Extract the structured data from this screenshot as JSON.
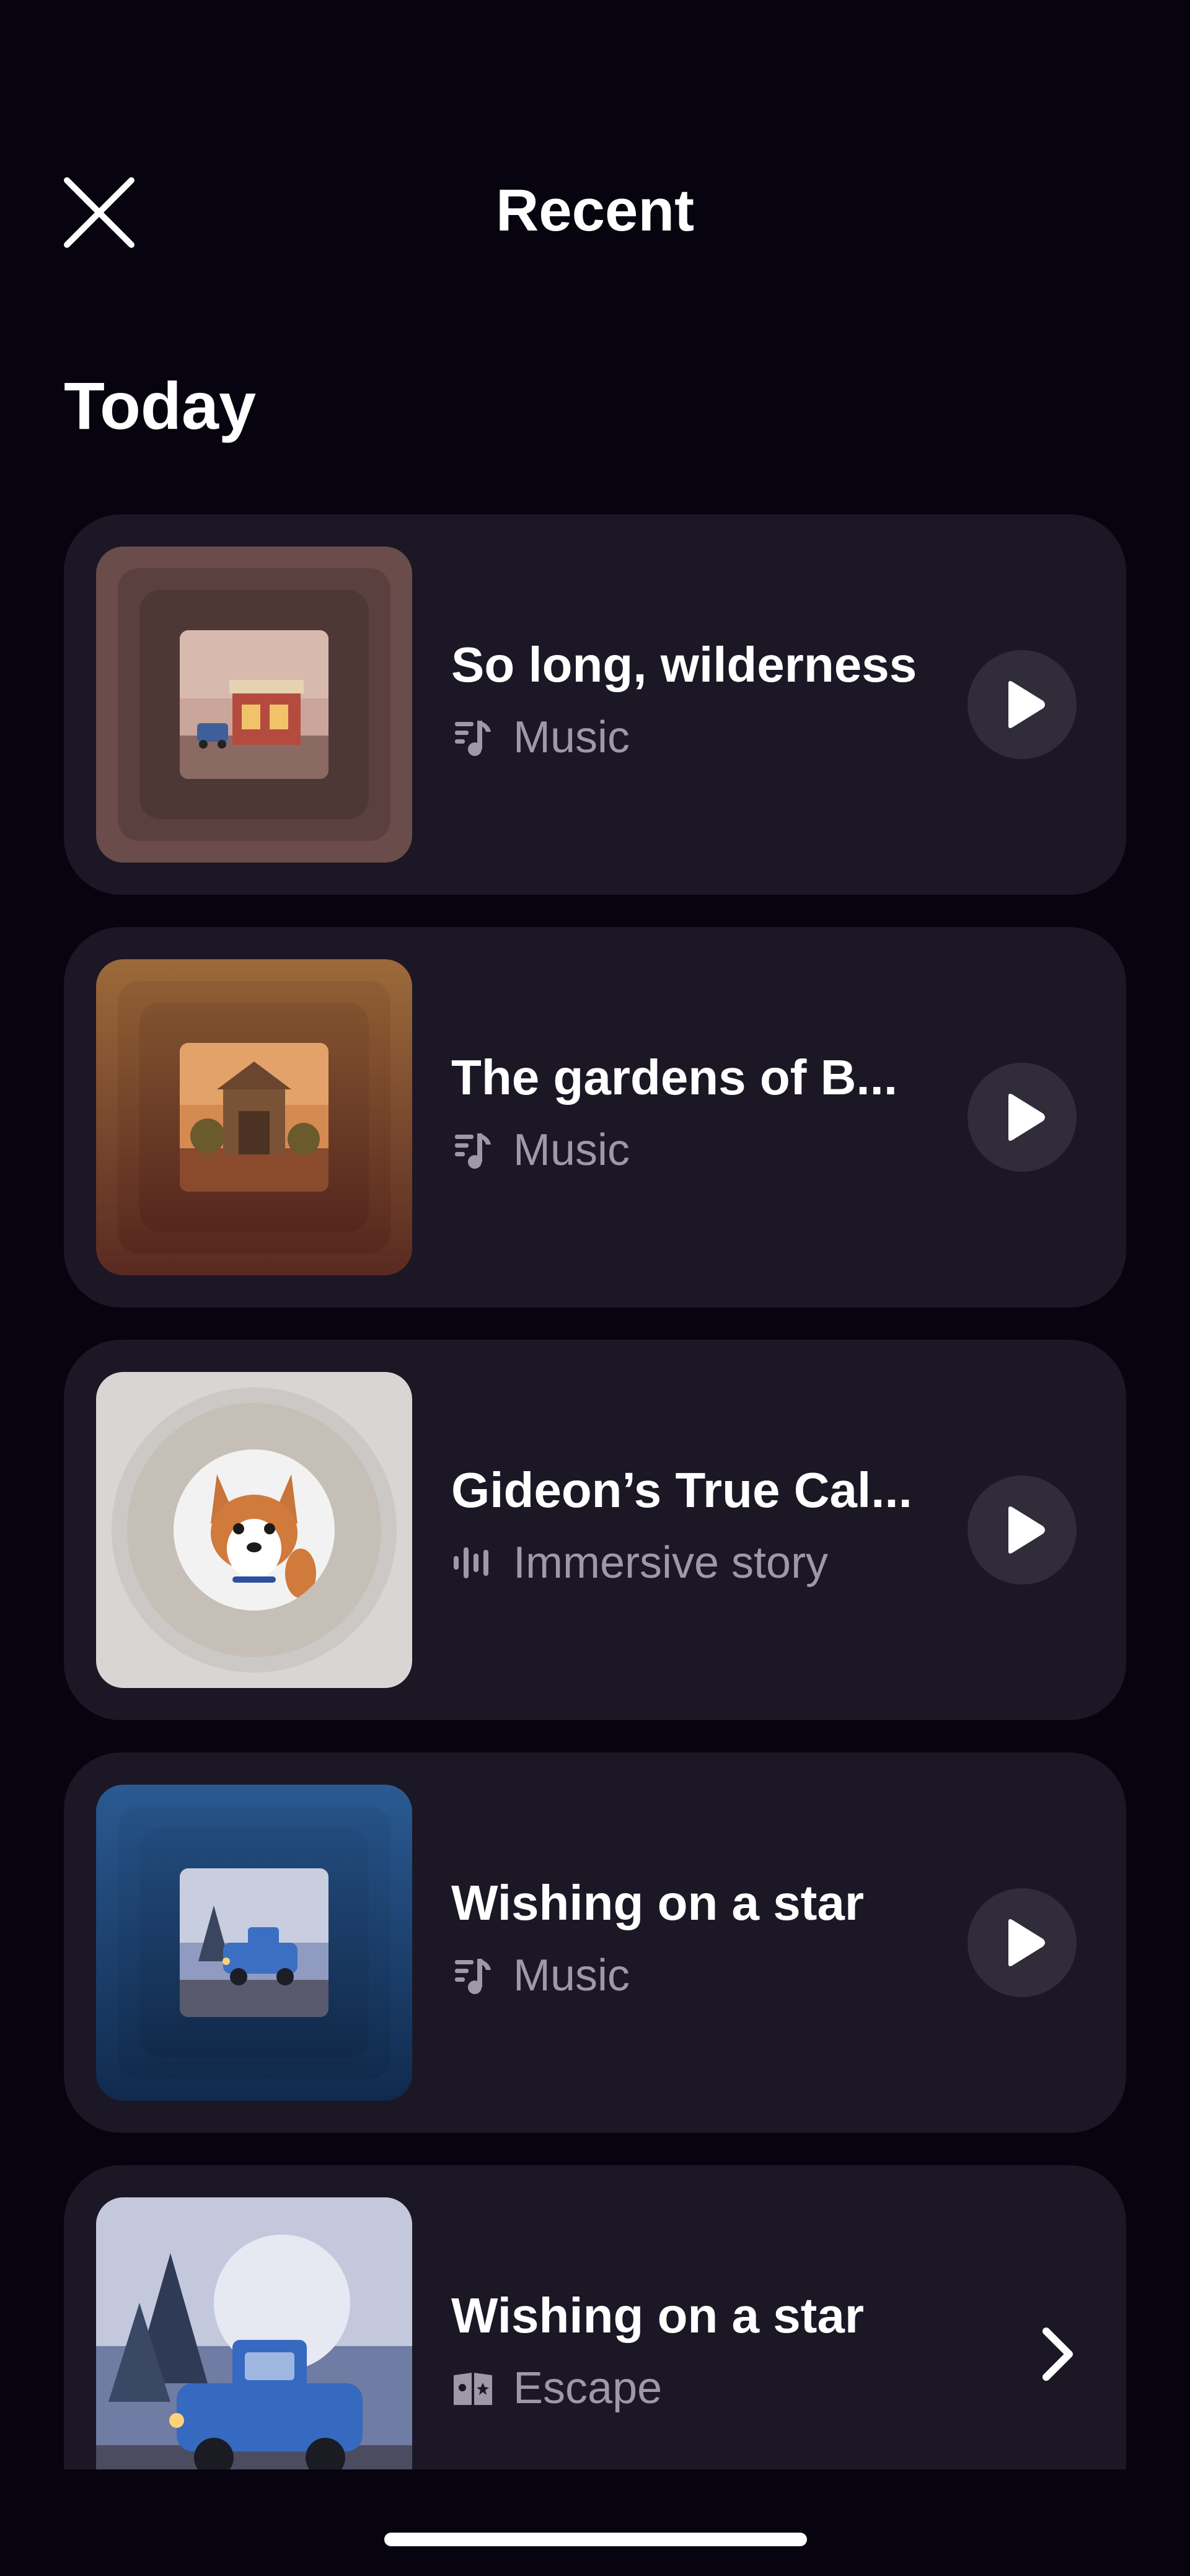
{
  "header": {
    "title": "Recent",
    "close_icon": "close-icon"
  },
  "section": {
    "title": "Today"
  },
  "items": [
    {
      "title": "So long, wilderness",
      "type": "Music",
      "type_icon": "music-icon",
      "action": "play",
      "artwork": "diner-scene"
    },
    {
      "title": "The gardens of B...",
      "type": "Music",
      "type_icon": "music-icon",
      "action": "play",
      "artwork": "gardens-temple"
    },
    {
      "title": "Gideon’s True Cal...",
      "type": "Immersive story",
      "type_icon": "audio-waveform-icon",
      "action": "play",
      "artwork": "corgi-dog"
    },
    {
      "title": "Wishing on a star",
      "type": "Music",
      "type_icon": "music-icon",
      "action": "play",
      "artwork": "blue-truck-snow"
    },
    {
      "title": "Wishing on a star",
      "type": "Escape",
      "type_icon": "book-icon",
      "action": "open",
      "artwork": "blue-truck-snow"
    }
  ],
  "colors": {
    "background": "#07040f",
    "card": "#1b1725",
    "secondary_text": "#9d99a6",
    "play_button": "#302c3a"
  }
}
